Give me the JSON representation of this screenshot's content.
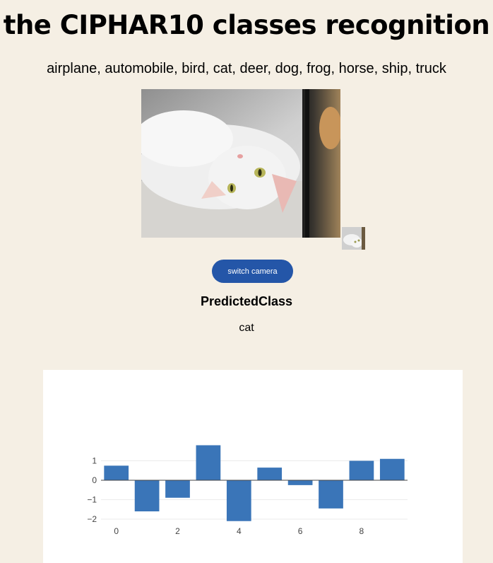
{
  "page": {
    "title": "the CIPHAR10 classes recognition",
    "subtitle": "airplane, automobile, bird, cat, deer, dog, frog, horse, ship, truck"
  },
  "controls": {
    "switch_camera_label": "switch camera"
  },
  "prediction": {
    "label": "PredictedClass",
    "value": "cat"
  },
  "colors": {
    "background": "#f5efe4",
    "button": "#2456a8",
    "bar": "#3a75b8"
  },
  "chart_data": {
    "type": "bar",
    "x": [
      0,
      1,
      2,
      3,
      4,
      5,
      6,
      7,
      8,
      9
    ],
    "values": [
      0.75,
      -1.6,
      -0.9,
      1.8,
      -2.1,
      0.65,
      -0.25,
      -1.45,
      1.0,
      1.1
    ],
    "xticks": [
      "0",
      "2",
      "4",
      "6",
      "8"
    ],
    "yticks": [
      "1",
      "0",
      "−1",
      "−2"
    ],
    "ylim": [
      -2.1,
      1.8
    ],
    "grid": true,
    "title": "",
    "xlabel": "",
    "ylabel": ""
  }
}
